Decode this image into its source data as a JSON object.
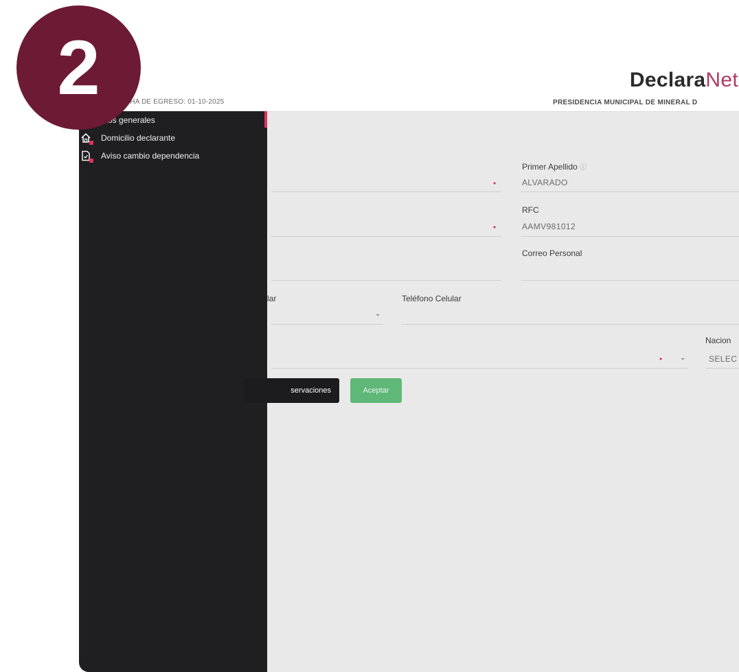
{
  "badge": {
    "number": "2"
  },
  "header": {
    "logo_primary": "Declara",
    "logo_secondary": "Net",
    "egreso_text": "ECHA DE EGRESO: 01-10-2025",
    "institution": "PRESIDENCIA MUNICIPAL DE MINERAL D"
  },
  "sidebar": {
    "items": [
      {
        "label": "atos generales",
        "icon": "user-icon"
      },
      {
        "label": "Domicilio declarante",
        "icon": "home-icon"
      },
      {
        "label": "Aviso cambio dependencia",
        "icon": "document-icon"
      }
    ]
  },
  "form": {
    "primer_apellido_label": "Primer Apellido",
    "primer_apellido_value": "ALVARADO",
    "rfc_label": "RFC",
    "rfc_value": "AAMV981012",
    "correo_label": "Correo Personal",
    "celular_partial_label": "lar",
    "telefono_label": "Teléfono Celular",
    "nacion_label": "Nacion",
    "nacion_value": "SELEC"
  },
  "buttons": {
    "observaciones": "servaciones",
    "aceptar": "Aceptar"
  },
  "colors": {
    "badge": "#6d1a35",
    "sidebar": "#1f1e21",
    "accent": "#e0325b",
    "accept_button": "#5fb778"
  }
}
